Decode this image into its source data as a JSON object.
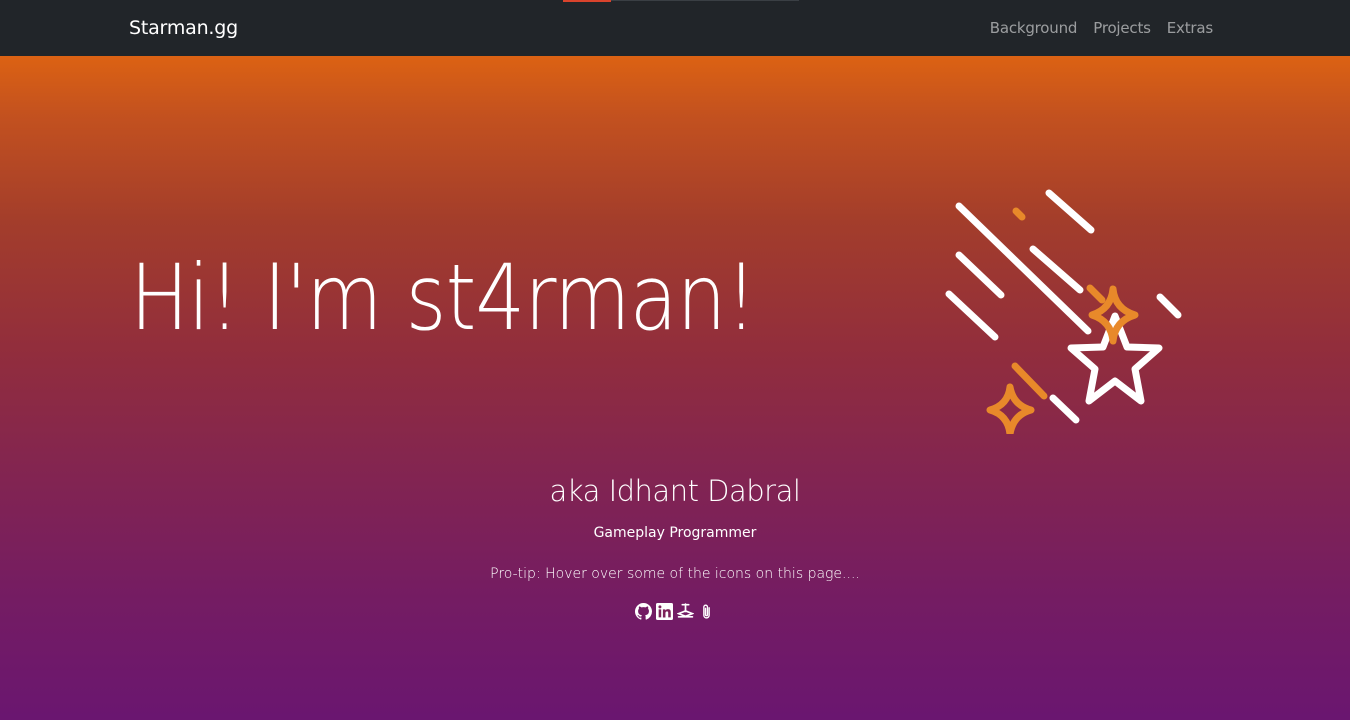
{
  "navbar": {
    "brand": "Starman.gg",
    "links": [
      {
        "label": "Background"
      },
      {
        "label": "Projects"
      },
      {
        "label": "Extras"
      }
    ]
  },
  "hero": {
    "headline": "Hi! I'm st4rman!",
    "illustration_icon": "shooting-star-icon",
    "alias": "aka Idhant Dabral",
    "role": "Gameplay Programmer",
    "tip": "Pro-tip: Hover over some of the icons on this page....",
    "social": [
      {
        "icon": "github-icon"
      },
      {
        "icon": "linkedin-icon"
      },
      {
        "icon": "steam-icon"
      },
      {
        "icon": "paperclip-icon"
      }
    ]
  },
  "colors": {
    "navbar_bg": "#212529",
    "gradient_top": "#dc6213",
    "gradient_bottom": "#6a1670",
    "accent_orange": "#e8892a",
    "text": "#ffffff"
  }
}
